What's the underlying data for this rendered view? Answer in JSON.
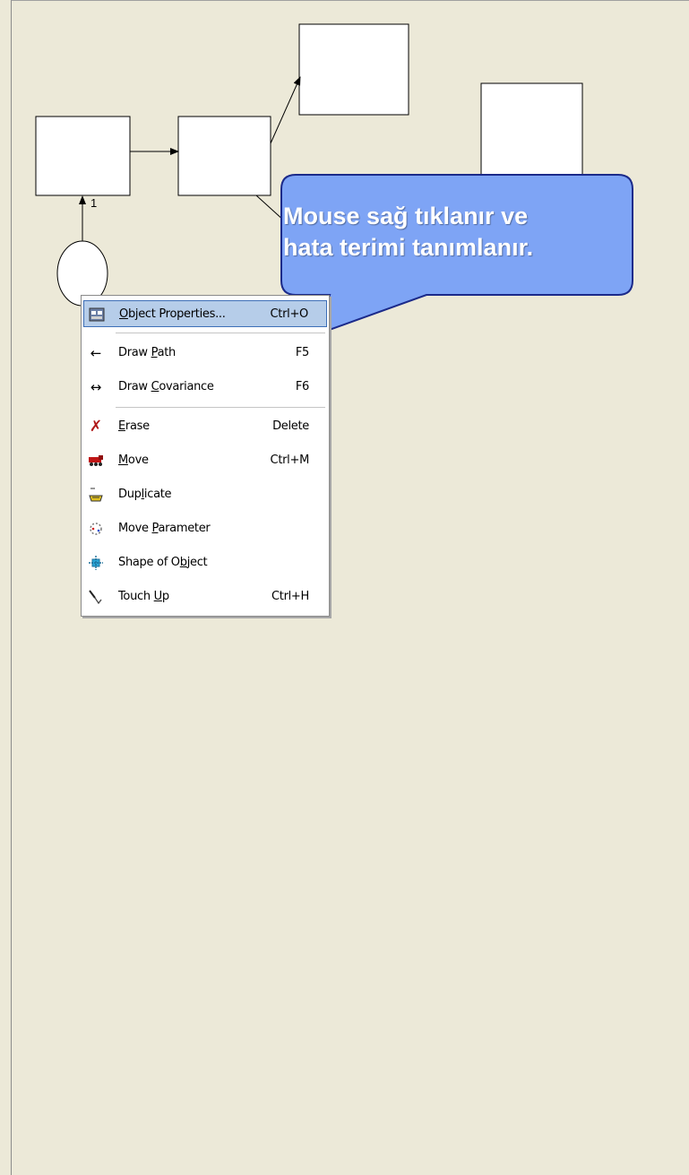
{
  "callout": {
    "line1": "Mouse sağ tıklanır ve",
    "line2": "hata terimi tanımlanır.",
    "fill": "#7ea4f5"
  },
  "diagram": {
    "path_label": "1"
  },
  "menu": {
    "highlight_color": "#b6cde9",
    "items": [
      {
        "label": "Object Properties...",
        "mnemonic": "O",
        "shortcut": "Ctrl+O",
        "icon": "object-properties-icon",
        "highlighted": true
      },
      {
        "label": "Draw Path",
        "mnemonic": "P",
        "shortcut": "F5",
        "icon": "left-arrow-icon"
      },
      {
        "label": "Draw Covariance",
        "mnemonic": "C",
        "shortcut": "F6",
        "icon": "double-arrow-icon"
      },
      {
        "label": "Erase",
        "mnemonic": "E",
        "shortcut": "Delete",
        "icon": "erase-x-icon"
      },
      {
        "label": "Move",
        "mnemonic": "M",
        "shortcut": "Ctrl+M",
        "icon": "move-truck-icon"
      },
      {
        "label": "Duplicate",
        "mnemonic": "l",
        "shortcut": "",
        "icon": "duplicate-icon"
      },
      {
        "label": "Move Parameter",
        "mnemonic": "P",
        "shortcut": "",
        "icon": "move-parameter-icon"
      },
      {
        "label": "Shape of Object",
        "mnemonic": "b",
        "shortcut": "",
        "icon": "shape-of-object-icon"
      },
      {
        "label": "Touch Up",
        "mnemonic": "U",
        "shortcut": "Ctrl+H",
        "icon": "touch-up-icon"
      }
    ]
  }
}
